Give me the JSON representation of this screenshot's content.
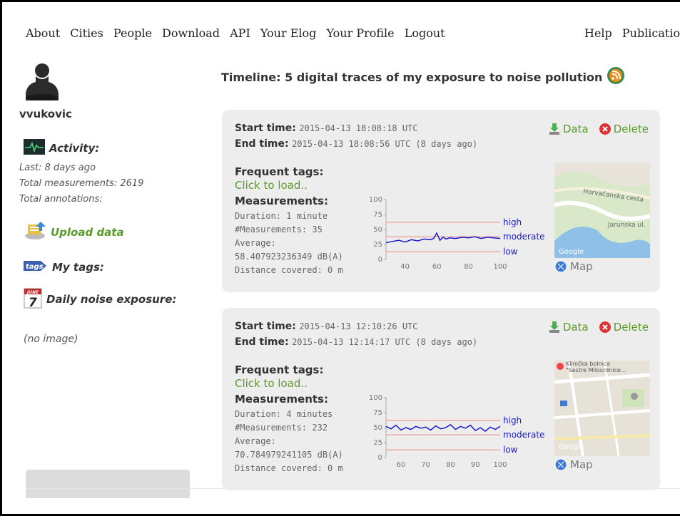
{
  "nav": {
    "left": [
      "About",
      "Cities",
      "People",
      "Download",
      "API",
      "Your Elog",
      "Your Profile",
      "Logout"
    ],
    "right": [
      "Help",
      "Publicatio"
    ]
  },
  "sidebar": {
    "username": "vvukovic",
    "activity_label": "Activity:",
    "last": "Last: 8 days ago",
    "total_measurements": "Total measurements: 2619",
    "total_annotations": "Total annotations:",
    "upload_label": "Upload data",
    "tags_icon_text": "tags",
    "tags_label": "My tags:",
    "calendar_month": "JUNE",
    "calendar_day": "7",
    "daily_label": "Daily noise exposure:",
    "no_image": "(no image)"
  },
  "timeline": {
    "title": "Timeline: 5 digital traces of my exposure to noise pollution"
  },
  "labels": {
    "start": "Start time:",
    "end": "End time:",
    "tags": "Frequent tags:",
    "click_load": "Click to load..",
    "measurements": "Measurements:",
    "data": "Data",
    "delete": "Delete",
    "map": "Map",
    "high": "high",
    "moderate": "moderate",
    "low": "low"
  },
  "traces": [
    {
      "start": "2015-04-13 18:08:18 UTC",
      "end": "2015-04-13 18:08:56 UTC (8 days ago)",
      "duration": "Duration: 1 minute",
      "count": "#Measurements: 35",
      "average_label": "Average:",
      "average": "58.407923236349 dB(A)",
      "distance": "Distance covered: 0 m",
      "map_text_1": "Horvaćanska cesta",
      "map_text_2": "Jarunska ul.",
      "map_logo": "Google"
    },
    {
      "start": "2015-04-13 12:10:26 UTC",
      "end": "2015-04-13 12:14:17 UTC (8 days ago)",
      "duration": "Duration: 4 minutes",
      "count": "#Measurements: 232",
      "average_label": "Average:",
      "average": "70.784979241105 dB(A)",
      "distance": "Distance covered: 0 m",
      "map_text_1": "Klinička bolnica",
      "map_text_2": "\"Sestre Milosrdnice...",
      "map_logo": "Google"
    }
  ],
  "chart_data": [
    {
      "type": "line",
      "ylim": [
        0,
        100
      ],
      "xlim": [
        28,
        100
      ],
      "yticks": [
        0,
        25,
        50,
        75,
        100
      ],
      "xticks": [
        40,
        60,
        80,
        100
      ],
      "thresholds": [
        {
          "label": "high",
          "value": 62
        },
        {
          "label": "moderate",
          "value": 38
        },
        {
          "label": "low",
          "value": 13
        }
      ],
      "series": [
        {
          "color": "#1a1acc",
          "x": [
            28,
            32,
            36,
            40,
            44,
            48,
            52,
            56,
            58,
            60,
            62,
            64,
            66,
            68,
            72,
            76,
            80,
            84,
            88,
            92,
            96,
            100
          ],
          "values": [
            28,
            30,
            32,
            29,
            33,
            31,
            34,
            33,
            35,
            44,
            32,
            37,
            34,
            36,
            35,
            37,
            36,
            38,
            35,
            37,
            36,
            35
          ]
        }
      ]
    },
    {
      "type": "line",
      "ylim": [
        0,
        100
      ],
      "xlim": [
        54,
        100
      ],
      "yticks": [
        0,
        25,
        50,
        75,
        100
      ],
      "xticks": [
        60,
        70,
        80,
        90,
        100
      ],
      "thresholds": [
        {
          "label": "high",
          "value": 62
        },
        {
          "label": "moderate",
          "value": 38
        },
        {
          "label": "low",
          "value": 13
        }
      ],
      "series": [
        {
          "color": "#1a1acc",
          "x": [
            54,
            56,
            58,
            60,
            62,
            64,
            66,
            68,
            70,
            72,
            74,
            76,
            78,
            80,
            82,
            84,
            86,
            88,
            90,
            92,
            94,
            96,
            98,
            100
          ],
          "values": [
            52,
            48,
            54,
            46,
            50,
            47,
            52,
            49,
            51,
            46,
            53,
            48,
            50,
            55,
            47,
            52,
            49,
            54,
            45,
            50,
            44,
            51,
            47,
            52
          ]
        }
      ]
    }
  ]
}
